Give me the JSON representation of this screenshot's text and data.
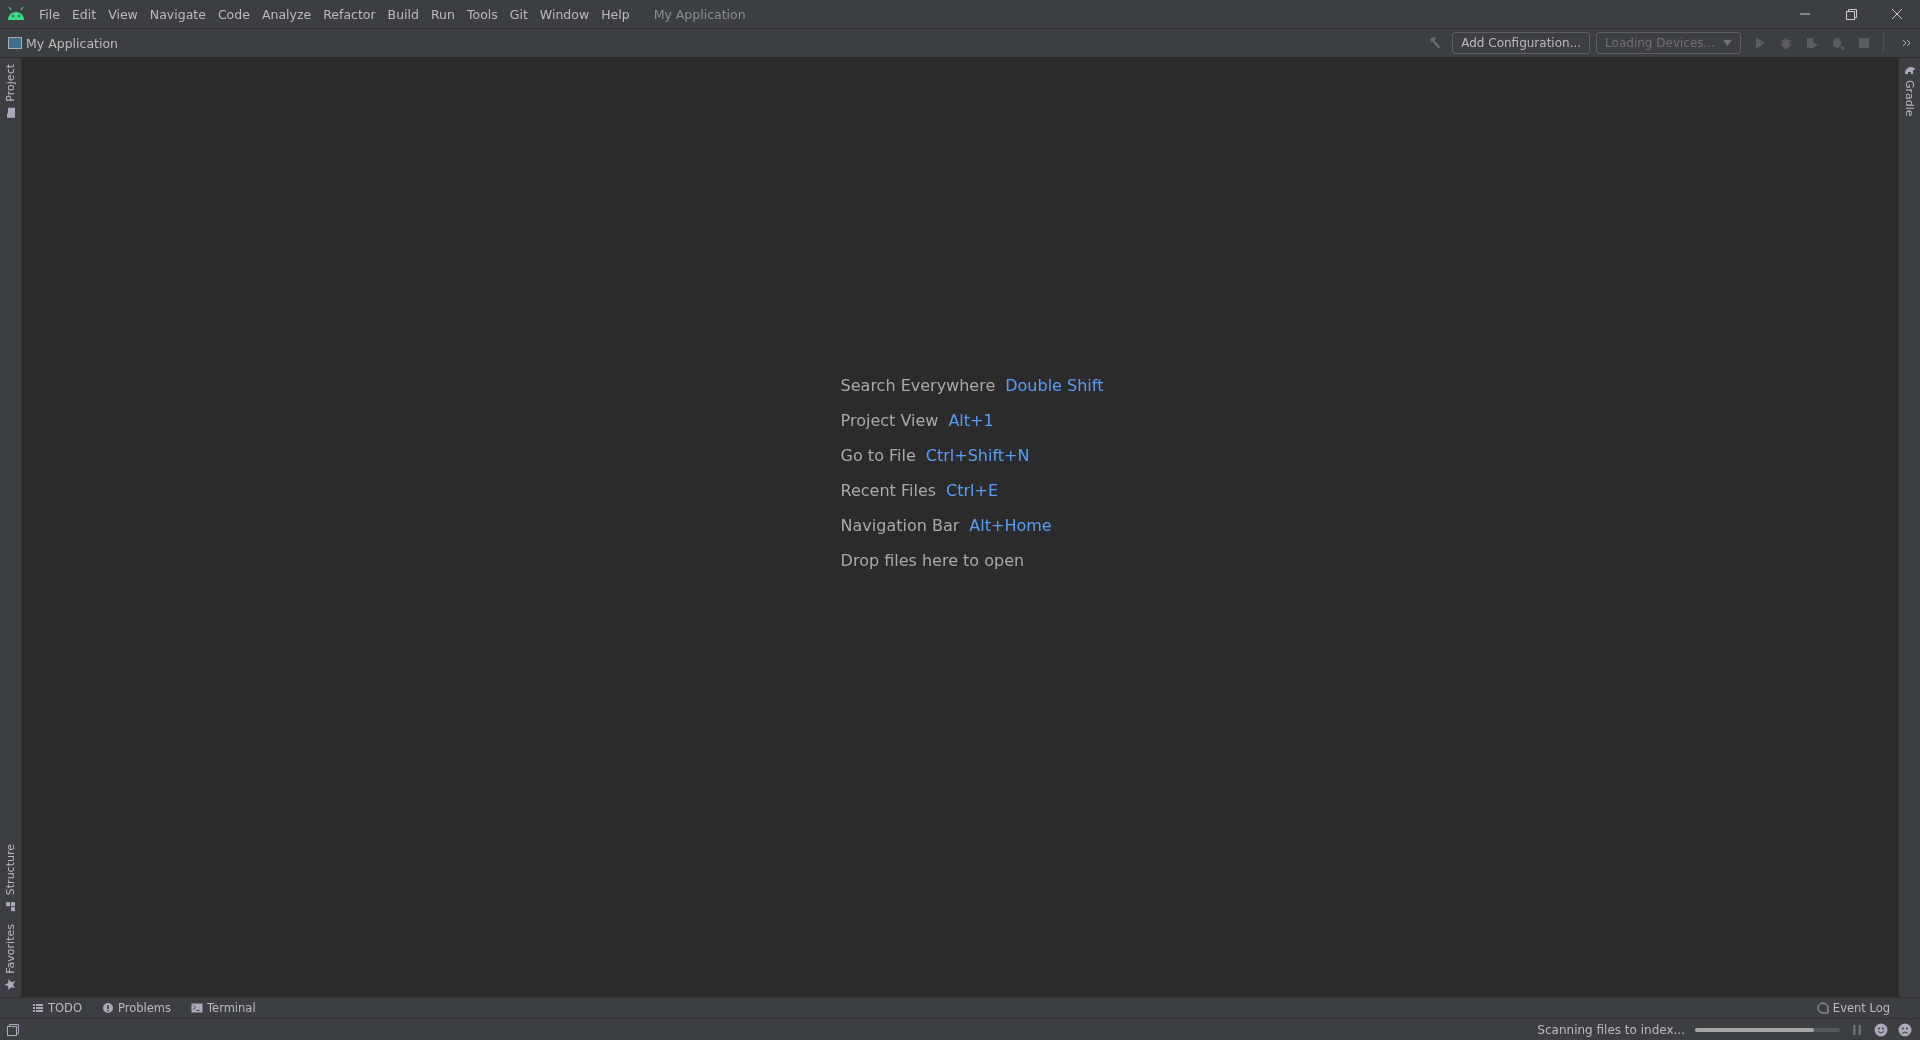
{
  "menu": [
    "File",
    "Edit",
    "View",
    "Navigate",
    "Code",
    "Analyze",
    "Refactor",
    "Build",
    "Run",
    "Tools",
    "Git",
    "Window",
    "Help"
  ],
  "window": {
    "title": "My Application"
  },
  "navbar": {
    "project": "My Application",
    "configuration": "Add Configuration...",
    "devices": {
      "label": "Loading Devices...",
      "disabled": true
    }
  },
  "left_tools": [
    {
      "label": "Project",
      "kind": "folder"
    },
    {
      "label": "Structure",
      "kind": "structure"
    },
    {
      "label": "Favorites",
      "kind": "star"
    }
  ],
  "right_tools": [
    {
      "label": "Gradle"
    }
  ],
  "hints": [
    {
      "label": "Search Everywhere",
      "shortcut": "Double Shift"
    },
    {
      "label": "Project View",
      "shortcut": "Alt+1"
    },
    {
      "label": "Go to File",
      "shortcut": "Ctrl+Shift+N"
    },
    {
      "label": "Recent Files",
      "shortcut": "Ctrl+E"
    },
    {
      "label": "Navigation Bar",
      "shortcut": "Alt+Home"
    },
    {
      "label": "Drop files here to open"
    }
  ],
  "bottom_tools": [
    {
      "label": "TODO",
      "kind": "list"
    },
    {
      "label": "Problems",
      "kind": "alert"
    },
    {
      "label": "Terminal",
      "kind": "terminal"
    }
  ],
  "event_log": "Event Log",
  "status": {
    "text": "Scanning files to index...",
    "level": 0.82
  }
}
